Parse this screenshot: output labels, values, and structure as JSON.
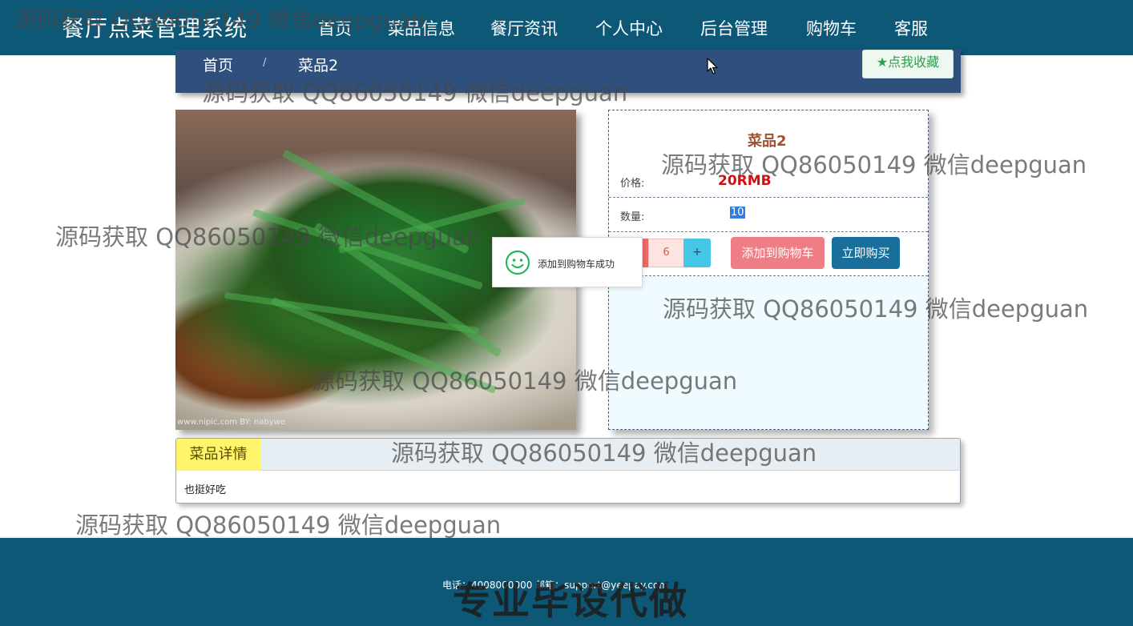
{
  "header": {
    "brand": "餐厅点菜管理系统",
    "nav": [
      "首页",
      "菜品信息",
      "餐厅资讯",
      "个人中心",
      "后台管理",
      "购物车",
      "客服"
    ]
  },
  "breadcrumb": {
    "home": "首页",
    "separator": "/",
    "current": "菜品2",
    "favorite_label": "★点我收藏"
  },
  "product": {
    "name": "菜品2",
    "price_label": "价格:",
    "price": "20RMB",
    "quantity_label": "数量:",
    "quantity": "10",
    "stepper_value": "6",
    "stepper_plus": "+",
    "add_to_cart_label": "添加到购物车",
    "buy_now_label": "立即购买",
    "image_caption": "www.nipic.com   BY: nabywe"
  },
  "toast": {
    "message": "添加到购物车成功"
  },
  "details": {
    "tab_label": "菜品详情",
    "text": "也挺好吃"
  },
  "footer": {
    "contact": "电话：4008000000  邮箱：support@yeepay.com",
    "promo": "专业毕设代做"
  },
  "watermark": "源码获取 QQ86050149 微信deepguan",
  "colors": {
    "nav_bg": "#0d5777",
    "crumb_bg": "#2f4f7c",
    "price": "#d01010",
    "add_cart": "#ef7d86",
    "buy_now": "#1a6f9a",
    "tab_highlight": "#fff56a"
  }
}
